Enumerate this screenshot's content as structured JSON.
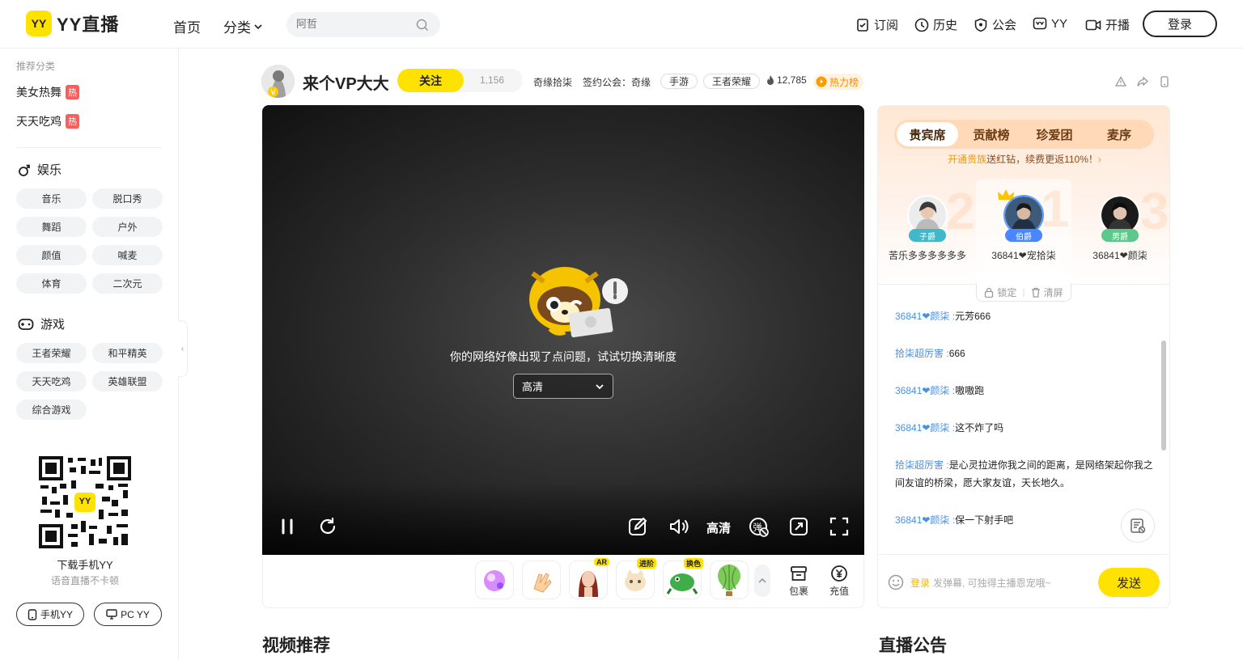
{
  "header": {
    "logo_badge": "YY",
    "logo_text": "YY直播",
    "nav_home": "首页",
    "nav_category": "分类",
    "search_placeholder": "阿哲",
    "nav_subscribe": "订阅",
    "nav_history": "历史",
    "nav_guild": "公会",
    "nav_yy": "YY",
    "nav_broadcast": "开播",
    "login": "登录"
  },
  "sidebar": {
    "recommend_title": "推荐分类",
    "recommended": [
      {
        "label": "美女热舞",
        "badge": "热"
      },
      {
        "label": "天天吃鸡",
        "badge": "热"
      }
    ],
    "section_entertainment": "娱乐",
    "entertainment": [
      "音乐",
      "脱口秀",
      "舞蹈",
      "户外",
      "颜值",
      "喊麦",
      "体育",
      "二次元"
    ],
    "section_games": "游戏",
    "games": [
      "王者荣耀",
      "和平精英",
      "天天吃鸡",
      "英雄联盟",
      "综合游戏"
    ],
    "qr_badge": "YY",
    "download_title": "下载手机YY",
    "download_sub": "语音直播不卡顿",
    "btn_mobile": "手机YY",
    "btn_pc": "PC YY"
  },
  "room": {
    "title": "来个VP大大",
    "avatar_badge": "V",
    "follow": "关注",
    "follow_count": "1,156",
    "anchor_name": "奇缘拾柒",
    "guild": "签约公会：奇缘",
    "tag_mobile": "手游",
    "tag_game": "王者荣耀",
    "heat": "12,785",
    "hot_rank": "热力榜"
  },
  "player": {
    "error_text": "你的网络好像出现了点问题，试试切换清晰度",
    "quality_value": "高清",
    "ctrl_quality": "高清"
  },
  "gifts": {
    "badges": [
      "",
      "",
      "AR",
      "进阶",
      "换色",
      ""
    ],
    "package": "包裹",
    "recharge": "充值"
  },
  "panel": {
    "tabs": [
      "贵宾席",
      "贡献榜",
      "珍爱团",
      "麦序"
    ],
    "promo_hl": "开通贵族",
    "promo_text": "送红钻，续费更返110%！",
    "podium": [
      {
        "num": "2",
        "rank": "子爵",
        "name": "苦乐多多多多多多"
      },
      {
        "num": "1",
        "rank": "伯爵",
        "name": "36841❤宠拾柒"
      },
      {
        "num": "3",
        "rank": "男爵",
        "name": "36841❤颜柒"
      }
    ],
    "lock": "锁定",
    "clear": "清屏",
    "messages": [
      {
        "user": "36841❤颜柒",
        "text": "元芳666"
      },
      {
        "user": "拾柒超厉害",
        "text": "666"
      },
      {
        "user": "36841❤颜柒",
        "text": "嗷嗷跑"
      },
      {
        "user": "36841❤颜柒",
        "text": "这不炸了吗"
      },
      {
        "user": "拾柒超厉害",
        "text": "是心灵拉进你我之间的距离，是网络架起你我之间友谊的桥梁，愿大家友谊，天长地久。"
      },
      {
        "user": "36841❤颜柒",
        "text": "保一下射手吧"
      }
    ],
    "input_login": "登录",
    "input_placeholder": "发弹幕, 可独得主播恩宠哦~",
    "send": "发送"
  },
  "sections": {
    "video_rec": "视频推荐",
    "announcement": "直播公告"
  },
  "colors": {
    "brand_yellow": "#ffe200",
    "user_blue": "#4a90e2",
    "hot_red": "#ff5b5b"
  }
}
